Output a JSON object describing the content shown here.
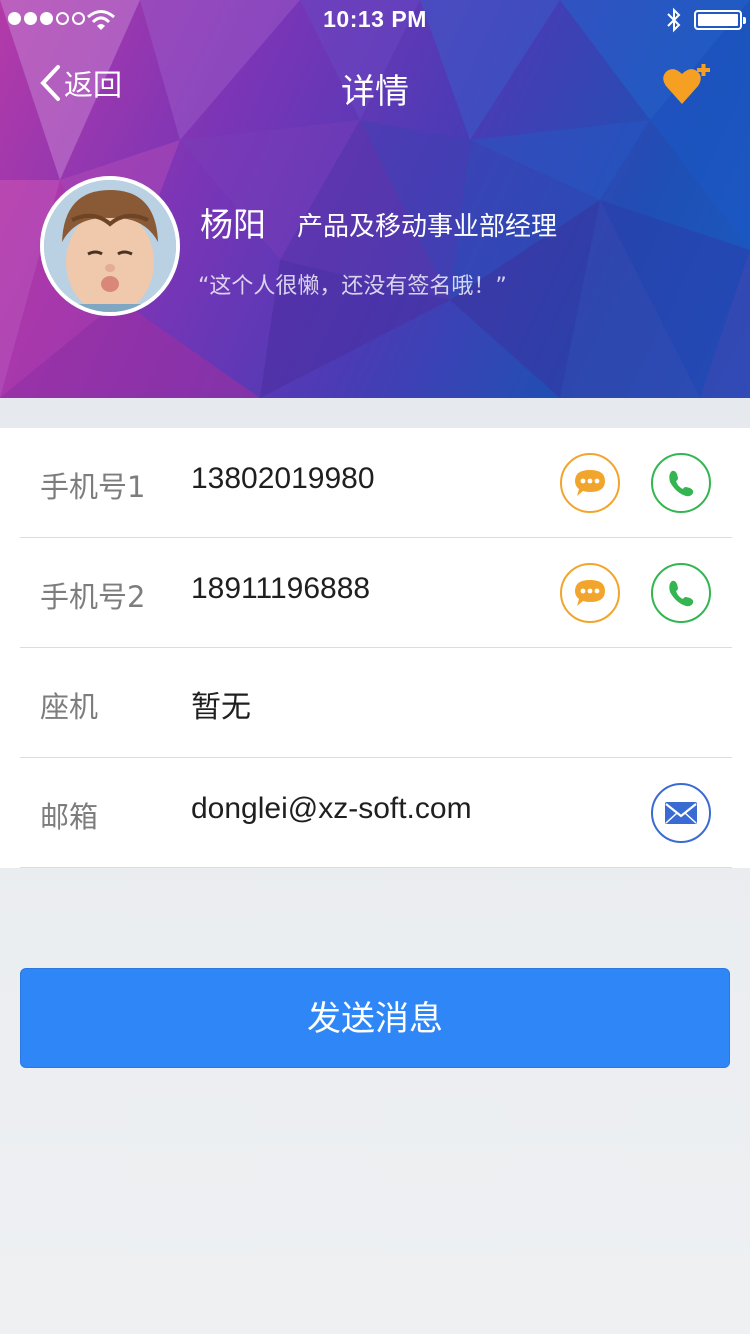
{
  "status_bar": {
    "time": "10:13 PM",
    "signal_bars_filled": 3,
    "signal_bars_total": 5
  },
  "navbar": {
    "back_label": "返回",
    "title": "详情"
  },
  "profile": {
    "name": "杨阳",
    "role": "产品及移动事业部经理",
    "signature": "“这个人很懒，还没有签名哦！”"
  },
  "contacts": [
    {
      "label": "手机号1",
      "value": "13802019980"
    },
    {
      "label": "手机号2",
      "value": "18911196888"
    },
    {
      "label": "座机",
      "value": "暂无"
    },
    {
      "label": "邮箱",
      "value": "donglei@xz-soft.com"
    }
  ],
  "send_button": {
    "label": "发送消息"
  },
  "colors": {
    "message_icon": "#f2a52c",
    "call_icon": "#33b552",
    "mail_icon": "#3a6bd2",
    "primary_button": "#2f86f7",
    "favorite_icon": "#f5a023"
  },
  "icons": {
    "back": "chevron-left-icon",
    "favorite": "heart-plus-icon",
    "message": "chat-bubble-icon",
    "call": "phone-icon",
    "mail": "envelope-icon"
  }
}
